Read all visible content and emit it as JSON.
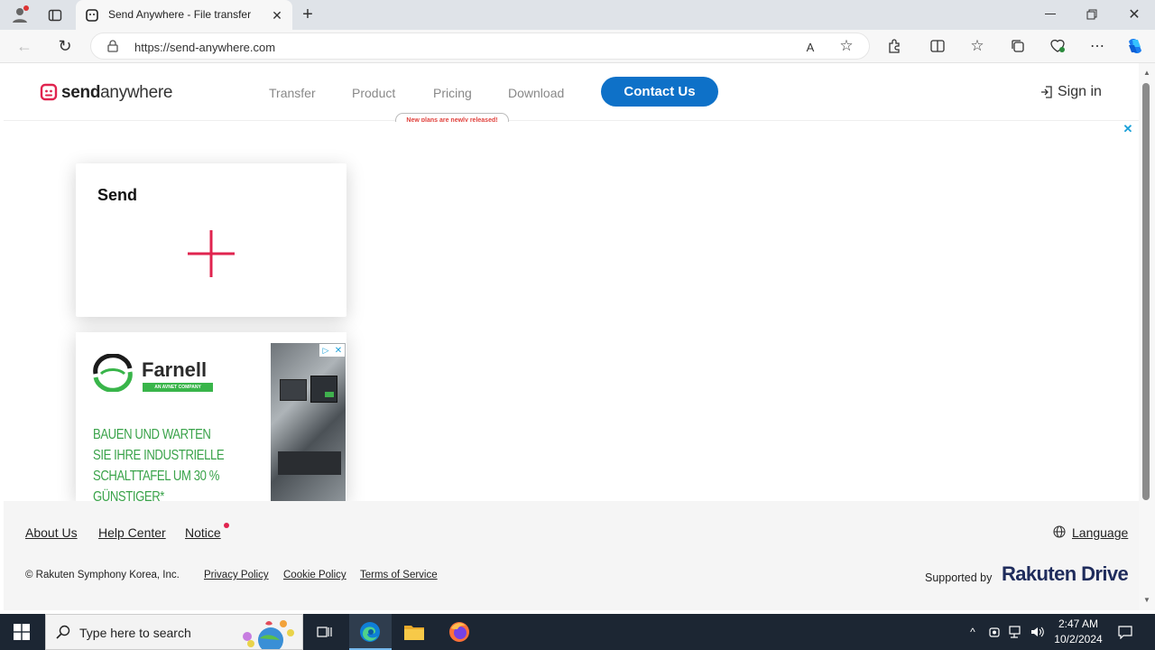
{
  "browser": {
    "tab_title": "Send Anywhere - File transfer",
    "url": "https://send-anywhere.com"
  },
  "site": {
    "logo_prefix": "send",
    "logo_suffix": "anywhere",
    "nav": [
      "Transfer",
      "Product",
      "Pricing",
      "Download"
    ],
    "contact_label": "Contact Us",
    "pricing_tooltip": "New plans are newly released!",
    "signin_label": "Sign in"
  },
  "send_card": {
    "title": "Send"
  },
  "ad": {
    "brand": "Farnell",
    "tagline": "AN AVNET COMPANY",
    "lines": [
      "BAUEN UND WARTEN",
      "SIE IHRE INDUSTRIELLE",
      "SCHALTTAFEL UM 30 %",
      "GÜNSTIGER*"
    ]
  },
  "footer": {
    "links": [
      "About Us",
      "Help Center",
      "Notice"
    ],
    "language_label": "Language",
    "copyright": "© Rakuten Symphony Korea, Inc.",
    "legal_links": [
      "Privacy Policy",
      "Cookie Policy",
      "Terms of Service"
    ],
    "supported_by": "Supported by",
    "sponsor": "Rakuten Drive"
  },
  "taskbar": {
    "search_placeholder": "Type here to search",
    "time": "2:47 AM",
    "date": "10/2/2024"
  },
  "colors": {
    "brand_red": "#e0244f",
    "contact_blue": "#0e71c8",
    "taskbar": "#1c2633"
  }
}
